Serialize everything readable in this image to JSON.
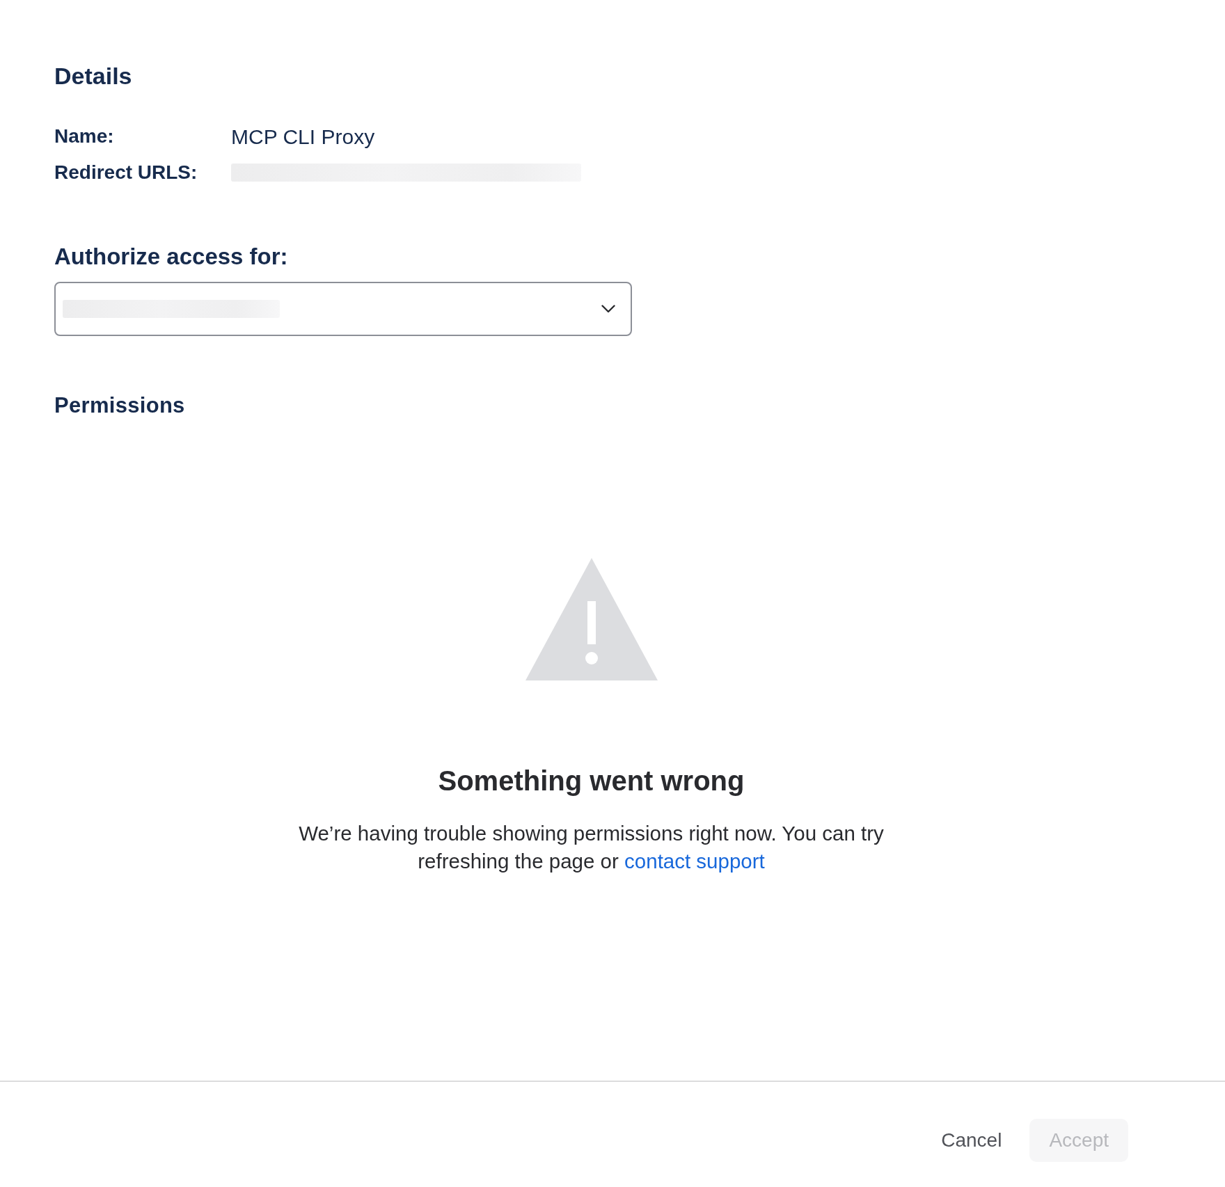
{
  "details": {
    "title": "Details",
    "fields": [
      {
        "label": "Name:",
        "value": "MCP CLI Proxy",
        "redacted": false
      },
      {
        "label": "Redirect URLS:",
        "redacted": true
      }
    ]
  },
  "authorize": {
    "label": "Authorize access for:",
    "select": {
      "redacted": true
    }
  },
  "permissions": {
    "title": "Permissions",
    "error": {
      "title": "Something went wrong",
      "message": "We’re having trouble showing permissions right now. You can try refreshing the page or",
      "link": "contact support"
    }
  },
  "footer": {
    "buttons": [
      {
        "label": "Cancel",
        "kind": "subtle",
        "disabled": false
      },
      {
        "label": "Accept",
        "kind": "primary",
        "disabled": true
      }
    ]
  }
}
